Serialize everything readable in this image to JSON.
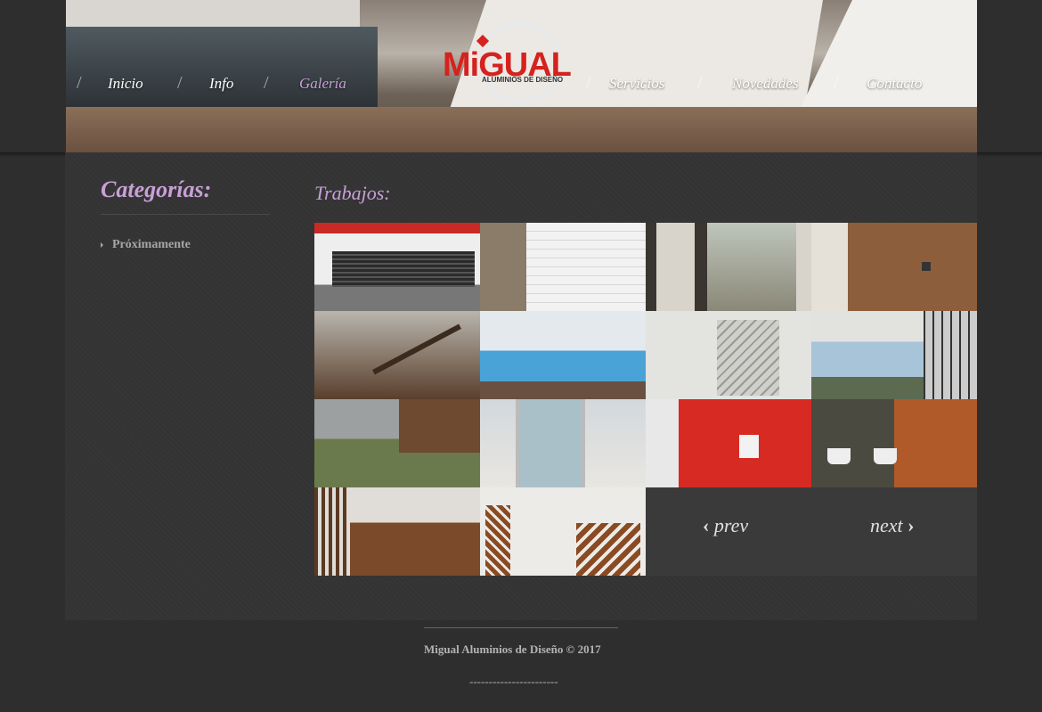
{
  "nav": {
    "items": [
      {
        "label": "Inicio",
        "active": false
      },
      {
        "label": "Info",
        "active": false
      },
      {
        "label": "Galería",
        "active": true
      },
      {
        "label": "Servicios",
        "active": false
      },
      {
        "label": "Novedades",
        "active": false
      },
      {
        "label": "Contacto",
        "active": false
      }
    ],
    "separator": "/"
  },
  "logo": {
    "brand": "MiGUAL",
    "tagline": "ALUMINIOS DE DISEÑO"
  },
  "sidebar": {
    "title": "Categorías:",
    "items": [
      "Próximamente"
    ]
  },
  "gallery": {
    "title": "Trabajos:",
    "thumbnails": [
      "fence-photo",
      "garage-door-photo",
      "courtyard-window-photo",
      "wood-panel-photo",
      "staircase-interior-photo",
      "pool-glass-photo",
      "stairs-photo",
      "window-view-photo",
      "garden-house-photo",
      "white-building-photo",
      "red-facade-photo",
      "palm-window-photo",
      "wood-facade-photo",
      "corten-gate-photo"
    ]
  },
  "pager": {
    "prev_label": "prev",
    "next_label": "next",
    "prev_arrow": "‹",
    "next_arrow": "›"
  },
  "footer": {
    "text": "Migual Aluminios de Diseño © 2017",
    "dashes": "-----------------------"
  },
  "colors": {
    "accent": "#c9a0d8",
    "logo_red": "#d6221e",
    "background": "#2e2e2e"
  }
}
